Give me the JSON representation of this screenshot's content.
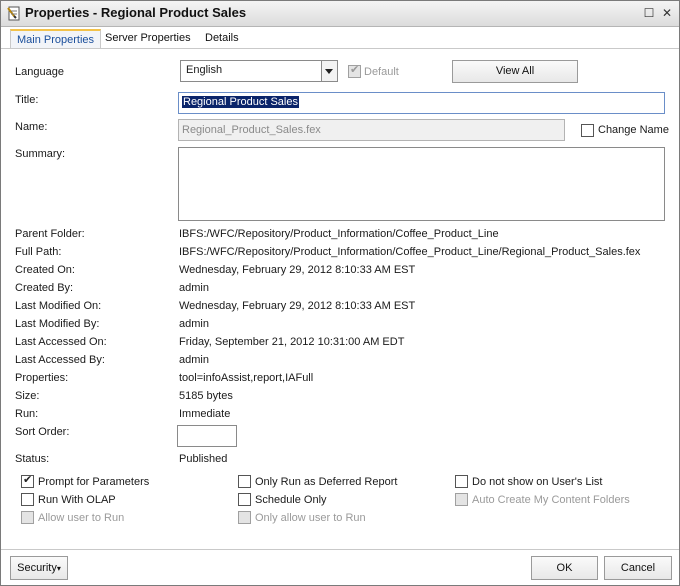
{
  "window": {
    "title": "Properties - Regional Product Sales"
  },
  "tabs": [
    {
      "label": "Main Properties"
    },
    {
      "label": "Server Properties"
    },
    {
      "label": "Details"
    }
  ],
  "language": {
    "label": "Language",
    "value": "English",
    "default_label": "Default",
    "view_all": "View All"
  },
  "title_field": {
    "label": "Title:",
    "value": "Regional Product Sales"
  },
  "name_field": {
    "label": "Name:",
    "value": "Regional_Product_Sales.fex",
    "change_name_label": "Change Name"
  },
  "summary": {
    "label": "Summary:",
    "value": ""
  },
  "info": {
    "parent_folder": {
      "label": "Parent Folder:",
      "value": "IBFS:/WFC/Repository/Product_Information/Coffee_Product_Line"
    },
    "full_path": {
      "label": "Full Path:",
      "value": "IBFS:/WFC/Repository/Product_Information/Coffee_Product_Line/Regional_Product_Sales.fex"
    },
    "created_on": {
      "label": "Created On:",
      "value": "Wednesday, February 29, 2012 8:10:33 AM EST"
    },
    "created_by": {
      "label": "Created By:",
      "value": "admin"
    },
    "last_modified_on": {
      "label": "Last Modified On:",
      "value": "Wednesday, February 29, 2012 8:10:33 AM EST"
    },
    "last_modified_by": {
      "label": "Last Modified By:",
      "value": "admin"
    },
    "last_accessed_on": {
      "label": "Last Accessed On:",
      "value": "Friday, September 21, 2012 10:31:00 AM EDT"
    },
    "last_accessed_by": {
      "label": "Last Accessed By:",
      "value": "admin"
    },
    "properties": {
      "label": "Properties:",
      "value": "tool=infoAssist,report,IAFull"
    },
    "size": {
      "label": "Size:",
      "value": "5185 bytes"
    },
    "run": {
      "label": "Run:",
      "value": "Immediate"
    },
    "sort_order": {
      "label": "Sort Order:",
      "value": ""
    },
    "status": {
      "label": "Status:",
      "value": "Published"
    }
  },
  "options": {
    "prompt_for_parameters": {
      "label": "Prompt for Parameters",
      "checked": true
    },
    "only_run_deferred": {
      "label": "Only Run as Deferred Report",
      "checked": false
    },
    "do_not_show": {
      "label": "Do not show on User's List",
      "checked": false
    },
    "run_with_olap": {
      "label": "Run With OLAP",
      "checked": false
    },
    "schedule_only": {
      "label": "Schedule Only",
      "checked": false
    },
    "auto_create_folders": {
      "label": "Auto Create My Content Folders",
      "checked": false
    },
    "allow_user_to_run": {
      "label": "Allow user to Run",
      "checked": false
    },
    "only_allow_user_to_run": {
      "label": "Only allow user to Run",
      "checked": false
    }
  },
  "footer": {
    "security": "Security",
    "ok": "OK",
    "cancel": "Cancel"
  }
}
